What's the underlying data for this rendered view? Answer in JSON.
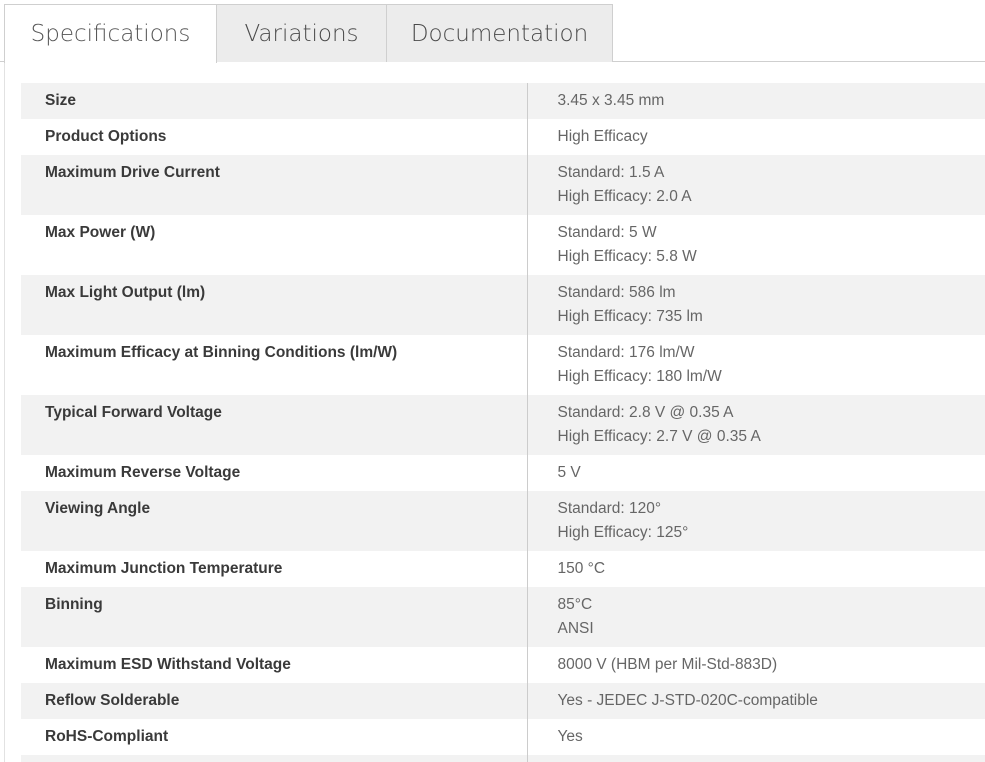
{
  "tabs": [
    {
      "label": "Specifications",
      "active": true
    },
    {
      "label": "Variations",
      "active": false
    },
    {
      "label": "Documentation",
      "active": false
    }
  ],
  "specs": {
    "rows": [
      {
        "label": "Size",
        "values": [
          "3.45 x 3.45 mm"
        ]
      },
      {
        "label": "Product Options",
        "values": [
          "High Efficacy"
        ]
      },
      {
        "label": "Maximum Drive Current",
        "values": [
          "Standard: 1.5 A",
          "High Efficacy: 2.0 A"
        ]
      },
      {
        "label": "Max Power (W)",
        "values": [
          "Standard: 5 W",
          "High Efficacy: 5.8 W"
        ]
      },
      {
        "label": "Max Light Output (lm)",
        "values": [
          "Standard: 586 lm",
          "High Efficacy: 735 lm"
        ]
      },
      {
        "label": "Maximum Efficacy at Binning Conditions (lm/W)",
        "values": [
          "Standard: 176 lm/W",
          "High Efficacy: 180 lm/W"
        ]
      },
      {
        "label": "Typical Forward Voltage",
        "values": [
          "Standard: 2.8 V @ 0.35 A",
          "High Efficacy: 2.7 V @ 0.35 A"
        ]
      },
      {
        "label": "Maximum Reverse Voltage",
        "values": [
          "5 V"
        ]
      },
      {
        "label": "Viewing Angle",
        "values": [
          "Standard: 120°",
          "High Efficacy: 125°"
        ]
      },
      {
        "label": "Maximum Junction Temperature",
        "values": [
          "150 °C"
        ]
      },
      {
        "label": "Binning",
        "values": [
          "85°C",
          "ANSI"
        ]
      },
      {
        "label": "Maximum ESD Withstand Voltage",
        "values": [
          "8000 V (HBM per Mil-Std-883D)"
        ]
      },
      {
        "label": "Reflow Solderable",
        "values": [
          "Yes - JEDEC J-STD-020C-compatible"
        ]
      },
      {
        "label": "RoHS-Compliant",
        "values": [
          "Yes"
        ]
      }
    ]
  }
}
